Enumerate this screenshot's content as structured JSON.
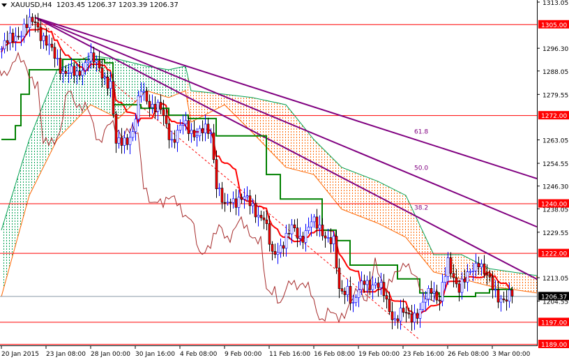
{
  "header": {
    "symbol": "XAUUSD,H4",
    "open": "1203.45",
    "high": "1206.37",
    "low": "1203.39",
    "close": "1206.37"
  },
  "chart_data": {
    "type": "candlestick",
    "title": "XAUUSD,H4",
    "ylim": [
      1189.0,
      1313.05
    ],
    "y_ticks": [
      "1313.05",
      "1296.30",
      "1288.05",
      "1279.55",
      "1263.05",
      "1254.55",
      "1246.30",
      "1238.05",
      "1229.55",
      "1213.05",
      "1204.55"
    ],
    "x_ticks": [
      {
        "bar": 0,
        "label": "20 Jan 2015"
      },
      {
        "bar": 16,
        "label": "23 Jan 08:00"
      },
      {
        "bar": 32,
        "label": "28 Jan 00:00"
      },
      {
        "bar": 48,
        "label": "30 Jan 16:00"
      },
      {
        "bar": 64,
        "label": "4 Feb 08:00"
      },
      {
        "bar": 80,
        "label": "9 Feb 00:00"
      },
      {
        "bar": 96,
        "label": "11 Feb 16:00"
      },
      {
        "bar": 112,
        "label": "16 Feb 08:00"
      },
      {
        "bar": 128,
        "label": "19 Feb 00:00"
      },
      {
        "bar": 144,
        "label": "23 Feb 16:00"
      },
      {
        "bar": 160,
        "label": "26 Feb 08:00"
      },
      {
        "bar": 176,
        "label": "3 Mar 00:00"
      }
    ],
    "current_price": "1206.37",
    "horizontal_levels": [
      {
        "price": 1305.0,
        "label": "1305.00"
      },
      {
        "price": 1272.0,
        "label": "1272.00"
      },
      {
        "price": 1240.0,
        "label": "1240.00"
      },
      {
        "price": 1222.0,
        "label": "1222.00"
      },
      {
        "price": 1197.0,
        "label": "1197.00"
      },
      {
        "price": 1189.0,
        "label": "1189.00"
      }
    ],
    "fan_lines": [
      {
        "label": "61.8",
        "from": [
          12,
          1307.5
        ],
        "to": [
          192,
          1249.0
        ]
      },
      {
        "label": "50.0",
        "from": [
          12,
          1307.5
        ],
        "to": [
          192,
          1231.5
        ]
      },
      {
        "label": "38.2",
        "from": [
          12,
          1307.5
        ],
        "to": [
          192,
          1212.5
        ]
      }
    ],
    "dashed_trend": {
      "from": [
        12,
        1307.5
      ],
      "to": [
        150,
        1190.5
      ]
    },
    "close_path": [
      [
        0,
        1296.1
      ],
      [
        5,
        1301.2
      ],
      [
        12,
        1306.2
      ],
      [
        17,
        1296.1
      ],
      [
        22,
        1288.5
      ],
      [
        27,
        1286.0
      ],
      [
        31,
        1293.6
      ],
      [
        35,
        1288.5
      ],
      [
        39,
        1283.4
      ],
      [
        41,
        1260.6
      ],
      [
        44,
        1263.2
      ],
      [
        47,
        1265.7
      ],
      [
        50,
        1280.9
      ],
      [
        54,
        1275.8
      ],
      [
        57,
        1273.3
      ],
      [
        61,
        1263.2
      ],
      [
        65,
        1268.2
      ],
      [
        70,
        1265.7
      ],
      [
        75,
        1265.7
      ],
      [
        77,
        1248.0
      ],
      [
        80,
        1237.9
      ],
      [
        82,
        1240.4
      ],
      [
        86,
        1242.9
      ],
      [
        90,
        1237.9
      ],
      [
        94,
        1235.3
      ],
      [
        97,
        1220.1
      ],
      [
        100,
        1225.2
      ],
      [
        104,
        1230.3
      ],
      [
        107,
        1227.7
      ],
      [
        111,
        1232.8
      ],
      [
        115,
        1230.3
      ],
      [
        119,
        1225.2
      ],
      [
        121,
        1207.5
      ],
      [
        124,
        1210.0
      ],
      [
        126,
        1202.4
      ],
      [
        130,
        1212.6
      ],
      [
        134,
        1210.0
      ],
      [
        137,
        1207.5
      ],
      [
        141,
        1197.3
      ],
      [
        144,
        1199.9
      ],
      [
        147,
        1199.9
      ],
      [
        150,
        1199.9
      ],
      [
        154,
        1210.0
      ],
      [
        157,
        1205.0
      ],
      [
        160,
        1217.6
      ],
      [
        164,
        1210.0
      ],
      [
        167,
        1212.6
      ],
      [
        171,
        1220.1
      ],
      [
        174,
        1212.6
      ],
      [
        177,
        1207.5
      ],
      [
        181,
        1205.0
      ],
      [
        183,
        1206.37
      ]
    ],
    "kijun": [
      [
        0,
        1263.2
      ],
      [
        5,
        1268.2
      ],
      [
        7,
        1279.6
      ],
      [
        10,
        1288.5
      ],
      [
        22,
        1292.3
      ],
      [
        37,
        1291.0
      ],
      [
        40,
        1275.8
      ],
      [
        50,
        1274.5
      ],
      [
        60,
        1272.0
      ],
      [
        67,
        1270.8
      ],
      [
        75,
        1270.8
      ],
      [
        77,
        1264.5
      ],
      [
        95,
        1250.5
      ],
      [
        100,
        1241.6
      ],
      [
        110,
        1241.6
      ],
      [
        115,
        1230.3
      ],
      [
        120,
        1226.5
      ],
      [
        125,
        1217.6
      ],
      [
        137,
        1217.6
      ],
      [
        142,
        1212.6
      ],
      [
        150,
        1207.5
      ],
      [
        157,
        1206.2
      ],
      [
        165,
        1206.2
      ],
      [
        170,
        1207.5
      ],
      [
        175,
        1208.8
      ],
      [
        183,
        1209.5
      ]
    ],
    "cloud": [
      [
        0,
        1230.3,
        1206.2
      ],
      [
        10,
        1263.2,
        1242.9
      ],
      [
        20,
        1288.5,
        1263.2
      ],
      [
        32,
        1293.6,
        1275.8
      ],
      [
        42,
        1292.3,
        1270.8
      ],
      [
        52,
        1289.8,
        1280.9
      ],
      [
        60,
        1288.5,
        1278.4
      ],
      [
        66,
        1289.8,
        1280.9
      ],
      [
        68,
        1280.9,
        1269.5
      ],
      [
        80,
        1279.6,
        1275.8
      ],
      [
        90,
        1278.4,
        1265.7
      ],
      [
        102,
        1275.8,
        1253.1
      ],
      [
        112,
        1263.2,
        1250.5
      ],
      [
        122,
        1253.1,
        1237.9
      ],
      [
        135,
        1248.0,
        1232.8
      ],
      [
        145,
        1242.9,
        1227.7
      ],
      [
        155,
        1221.4,
        1215.1
      ],
      [
        165,
        1221.4,
        1212.6
      ],
      [
        175,
        1216.3,
        1210.0
      ],
      [
        192,
        1213.8,
        1207.5
      ]
    ],
    "colors": {
      "bull": "#0000ff",
      "bear": "#ff0000",
      "kijun": "#008000",
      "tenkan": "#ff0000",
      "chikou": "#a52a2a",
      "cloud_bull": "#00a050",
      "cloud_bear": "#ff6600",
      "fan": "#800080",
      "level": "#ff0000"
    }
  }
}
